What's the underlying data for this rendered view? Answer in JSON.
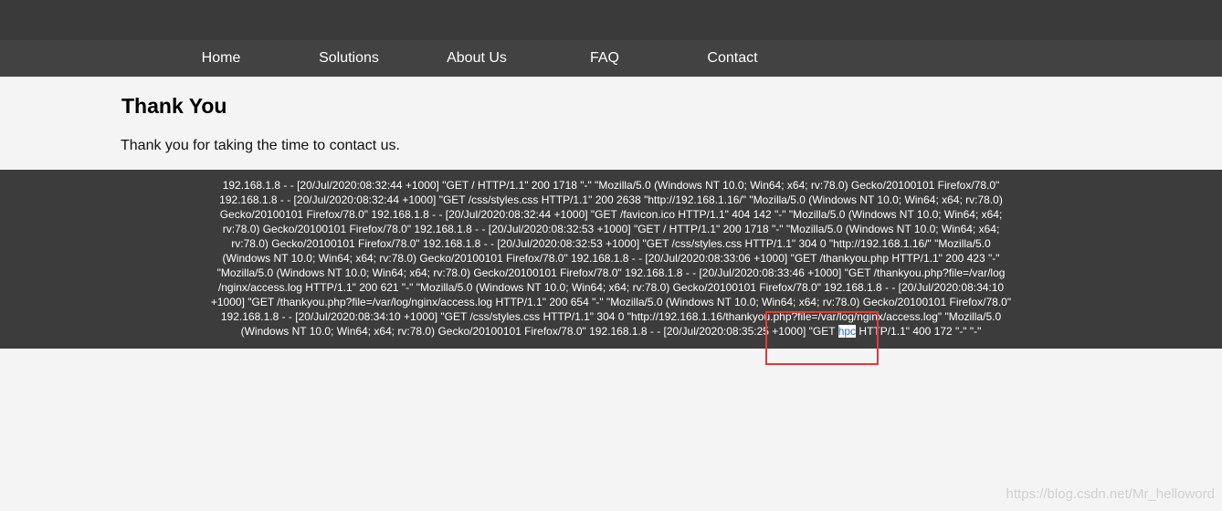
{
  "nav": {
    "items": [
      {
        "label": "Home"
      },
      {
        "label": "Solutions"
      },
      {
        "label": "About Us"
      },
      {
        "label": "FAQ"
      },
      {
        "label": "Contact"
      }
    ]
  },
  "main": {
    "title": "Thank You",
    "message": "Thank you for taking the time to contact us."
  },
  "log": {
    "lines": [
      "192.168.1.8 - - [20/Jul/2020:08:32:44 +1000] \"GET / HTTP/1.1\" 200 1718 \"-\" \"Mozilla/5.0 (Windows NT 10.0; Win64; x64; rv:78.0) Gecko/20100101 Firefox/78.0\"",
      "192.168.1.8 - - [20/Jul/2020:08:32:44 +1000] \"GET /css/styles.css HTTP/1.1\" 200 2638 \"http://192.168.1.16/\" \"Mozilla/5.0 (Windows NT 10.0; Win64; x64; rv:78.0)",
      "Gecko/20100101 Firefox/78.0\" 192.168.1.8 - - [20/Jul/2020:08:32:44 +1000] \"GET /favicon.ico HTTP/1.1\" 404 142 \"-\" \"Mozilla/5.0 (Windows NT 10.0; Win64; x64;",
      "rv:78.0) Gecko/20100101 Firefox/78.0\" 192.168.1.8 - - [20/Jul/2020:08:32:53 +1000] \"GET / HTTP/1.1\" 200 1718 \"-\" \"Mozilla/5.0 (Windows NT 10.0; Win64; x64;",
      "rv:78.0) Gecko/20100101 Firefox/78.0\" 192.168.1.8 - - [20/Jul/2020:08:32:53 +1000] \"GET /css/styles.css HTTP/1.1\" 304 0 \"http://192.168.1.16/\" \"Mozilla/5.0",
      "(Windows NT 10.0; Win64; x64; rv:78.0) Gecko/20100101 Firefox/78.0\" 192.168.1.8 - - [20/Jul/2020:08:33:06 +1000] \"GET /thankyou.php HTTP/1.1\" 200 423 \"-\"",
      "\"Mozilla/5.0 (Windows NT 10.0; Win64; x64; rv:78.0) Gecko/20100101 Firefox/78.0\" 192.168.1.8 - - [20/Jul/2020:08:33:46 +1000] \"GET /thankyou.php?file=/var/log",
      "/nginx/access.log HTTP/1.1\" 200 621 \"-\" \"Mozilla/5.0 (Windows NT 10.0; Win64; x64; rv:78.0) Gecko/20100101 Firefox/78.0\" 192.168.1.8 - - [20/Jul/2020:08:34:10",
      "+1000] \"GET /thankyou.php?file=/var/log/nginx/access.log HTTP/1.1\" 200 654 \"-\" \"Mozilla/5.0 (Windows NT 10.0; Win64; x64; rv:78.0) Gecko/20100101 Firefox/78.0\"",
      "192.168.1.8 - - [20/Jul/2020:08:34:10 +1000] \"GET /css/styles.css HTTP/1.1\" 304 0 \"http://192.168.1.16/thankyou.php?file=/var/log/nginx/access.log\" \"Mozilla/5.0"
    ],
    "last_line_before": "(Windows NT 10.0; Win64; x64; rv:78.0) Gecko/20100101 Firefox/78.0\" 192.168.1.8 - - [20/Jul/2020:08:35:25 +1000] \"GET ",
    "last_line_highlight": "hpc",
    "last_line_after": " HTTP/1.1\" 400 172 \"-\" \"-\""
  },
  "watermark": "https://blog.csdn.net/Mr_helloword",
  "colors": {
    "topbar": "#3a3a3a",
    "navbar": "#424242",
    "log_panel": "#3c3c3c",
    "annotation_box": "#e53935"
  }
}
